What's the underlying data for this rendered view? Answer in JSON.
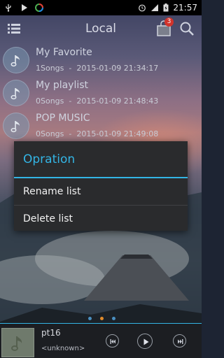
{
  "status_bar": {
    "time": "21:57",
    "icons": [
      "usb-icon",
      "play-icon",
      "app-icon",
      "alarm-icon",
      "signal-icon",
      "battery-charging-icon"
    ]
  },
  "header": {
    "title": "Local",
    "cart_badge": "3",
    "icons": [
      "menu-icon",
      "bag-icon",
      "search-icon"
    ]
  },
  "playlists": [
    {
      "name": "My Favorite",
      "count": "1Songs",
      "date": "2015-01-09 21:34:17"
    },
    {
      "name": "My playlist",
      "count": "0Songs",
      "date": "2015-01-09 21:48:43"
    },
    {
      "name": "POP MUSIC",
      "count": "0Songs",
      "date": "2015-01-09 21:49:08"
    }
  ],
  "dialog": {
    "title": "Opration",
    "items": [
      "Rename list",
      "Delete list"
    ]
  },
  "page_dots": {
    "count": 3,
    "active_index": 1
  },
  "player": {
    "title": "pt16",
    "artist": "<unknown>",
    "controls": [
      "previous-icon",
      "play-icon",
      "next-icon"
    ]
  },
  "colors": {
    "accent": "#33b5e5",
    "dialog_bg": "#2a2b2d",
    "badge": "#d2332b",
    "dot_active": "#e08a2a"
  }
}
